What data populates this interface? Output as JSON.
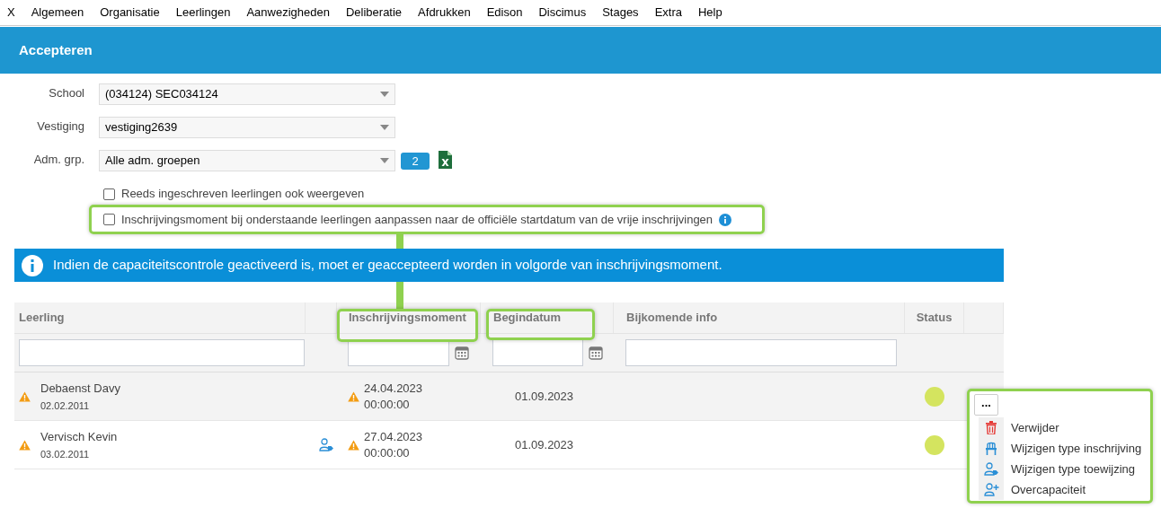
{
  "menu": [
    "X",
    "Algemeen",
    "Organisatie",
    "Leerlingen",
    "Aanwezigheden",
    "Deliberatie",
    "Afdrukken",
    "Edison",
    "Discimus",
    "Stages",
    "Extra",
    "Help"
  ],
  "page_title": "Accepteren",
  "fields": [
    {
      "label": "School",
      "value": "(034124) SEC034124"
    },
    {
      "label": "Vestiging",
      "value": "vestiging2639"
    },
    {
      "label": "Adm. grp.",
      "value": "Alle adm. groepen"
    }
  ],
  "count_button": "2",
  "checkboxes": [
    {
      "label": "Reeds ingeschreven leerlingen ook weergeven",
      "checked": false,
      "info": false
    },
    {
      "label": "Inschrijvingsmoment bij onderstaande leerlingen aanpassen naar de officiële startdatum van de vrije inschrijvingen",
      "checked": false,
      "info": true
    }
  ],
  "banner": "Indien de capaciteitscontrole geactiveerd is, moet er geaccepteerd worden in volgorde van inschrijvingsmoment.",
  "table": {
    "columns": [
      "Leerling",
      "Inschrijvingsmoment",
      "Begindatum",
      "Bijkomende info",
      "Status"
    ],
    "rows": [
      {
        "name": "Debaenst Davy",
        "birthdate": "02.02.2011",
        "warning": true,
        "assignment_icon": false,
        "moment_date": "24.04.2023",
        "moment_time": "00:00:00",
        "start": "01.09.2023",
        "color": "#d4e45f"
      },
      {
        "name": "Vervisch Kevin",
        "birthdate": "03.02.2011",
        "warning": true,
        "assignment_icon": true,
        "moment_date": "27.04.2023",
        "moment_time": "00:00:00",
        "start": "01.09.2023",
        "color": "#d4e45f"
      }
    ]
  },
  "context_menu": {
    "button": "...",
    "items": [
      {
        "label": "Verwijder",
        "kind": "delete"
      },
      {
        "label": "Wijzigen type inschrijving",
        "kind": "chair"
      },
      {
        "label": "Wijzigen type toewijzing",
        "kind": "assign"
      },
      {
        "label": "Overcapaciteit",
        "kind": "add"
      }
    ]
  }
}
